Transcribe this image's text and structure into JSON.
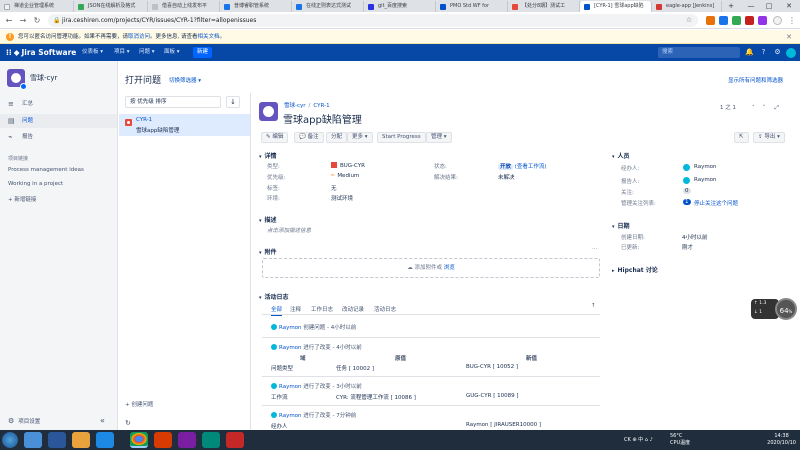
{
  "browser": {
    "tabs": [
      {
        "label": "禅道企业管理系统",
        "color": "#ffffff"
      },
      {
        "label": "JSON在线解析及格式",
        "color": "#34a853"
      },
      {
        "label": "借喜自动上线发布平",
        "color": "#e8eaed"
      },
      {
        "label": "普博睿职管系统",
        "color": "#1a73e8"
      },
      {
        "label": "在线正则表达式测试",
        "color": "#1a73e8"
      },
      {
        "label": "git_百度搜索",
        "color": "#2932e1"
      },
      {
        "label": "PMO Std WF for ",
        "color": "#0052cc"
      },
      {
        "label": "【处分8期】测试工",
        "color": "#e5493a"
      },
      {
        "label": "[CYR-1] 雪球app缺陷",
        "color": "#0052cc"
      },
      {
        "label": "eagle-app [Jenkins]",
        "color": "#d33833"
      }
    ],
    "new_tab": "+",
    "url": "jira.ceshiren.com/projects/CYR/issues/CYR-1?filter=allopenissues",
    "window_controls": [
      "—",
      "□",
      "✕"
    ]
  },
  "warning": {
    "text": "您可以匿名访问管理功能。如果不再需要，请",
    "link1": "取消访问",
    "mid": "。更多信息, 请查看",
    "link2": "相关文档",
    "end": "。"
  },
  "jira_nav": {
    "product": "Jira Software",
    "items": [
      "仪表板 ▾",
      "项目 ▾",
      "问题 ▾",
      "面板 ▾"
    ],
    "create": "新建",
    "search_placeholder": "搜索"
  },
  "sidebar": {
    "project_name": "雪球-cyr",
    "items": [
      {
        "label": "汇总",
        "icon": "≡"
      },
      {
        "label": "问题",
        "icon": "▤"
      },
      {
        "label": "报告",
        "icon": "📈"
      }
    ],
    "shortcuts_title": "项目链接",
    "links": [
      "Process management ideas",
      "Working in a project"
    ],
    "add_link": "+ 新增链接",
    "settings": "项目设置",
    "collapse": "«"
  },
  "filter": {
    "title": "打开问题",
    "switch": "切换筛选器 ▾",
    "view_all": "显示所有问题和筛选器",
    "sort": "按 优先级 排序",
    "sort_dir": "↓",
    "create_issue": "+ 创建问题",
    "refresh": "↻"
  },
  "issue_list": [
    {
      "key": "CYR-1",
      "summary": "雪球app缺陷管理"
    }
  ],
  "issue": {
    "project": "雪球-cyr",
    "key": "CYR-1",
    "title": "雪球app缺陷管理",
    "pager": "1 之 1",
    "toolbar": [
      "✎ 编辑",
      "💬 备注",
      "分配",
      "更多 ▾",
      "Start Progress",
      "管理 ▾"
    ],
    "export": "⇪ 导出 ▾",
    "details_title": "详情",
    "details": {
      "type_label": "类型:",
      "type_value": "BUG-CYR",
      "priority_label": "优先级:",
      "priority_value": "Medium",
      "labels_label": "标签:",
      "labels_value": "无",
      "env_label": "环境:",
      "env_value": "测试环境",
      "status_label": "状态:",
      "status_value": "开放",
      "status_link": "(查看工作流)",
      "resolution_label": "解决结果:",
      "resolution_value": "未解决"
    },
    "description_title": "描述",
    "description_placeholder": "点击添加描述信息",
    "attachments_title": "附件",
    "attach_text": "添加附件或",
    "attach_link": "浏览",
    "people_title": "人员",
    "people": {
      "assignee_label": "经办人:",
      "assignee": "Raymon",
      "reporter_label": "报告人:",
      "reporter": "Raymon",
      "votes_label": "关注:",
      "votes": "0",
      "watchers_label": "管理关注列表:",
      "watchers_count": "1",
      "watchers_link": "停止关注这个问题"
    },
    "dates_title": "日期",
    "dates": {
      "created_label": "创建日期:",
      "created": "4小时以前",
      "updated_label": "已更新:",
      "updated": "刚才"
    },
    "hipchat_title": "Hipchat 讨论",
    "activity_title": "活动日志",
    "activity_tabs": [
      "全部",
      "注释",
      "工作日志",
      "改动记录",
      "活动日志"
    ],
    "activity_sort": "↑",
    "activity": {
      "e1_user": "Raymon",
      "e1_text": "创建问题 - 4小时以前",
      "e2_user": "Raymon",
      "e2_text": "进行了改变 - 4小时以前",
      "col_field": "域",
      "col_old": "原值",
      "col_new": "新值",
      "e2_field": "问题类型",
      "e2_old": "任务 [ 10002 ]",
      "e2_new": "BUG-CYR [ 10052 ]",
      "e3_user": "Raymon",
      "e3_text": "进行了改变 - 3小时以前",
      "e3_field": "工作流",
      "e3_old": "CYR: 流程管理工作流 [ 10086 ]",
      "e3_new": "GUG-CYR [ 10089 ]",
      "e4_user": "Raymon",
      "e4_text": "进行了改变 - 7分钟前",
      "e4_field": "经办人",
      "e4_new": "Raymon [ JIRAUSER10000 ]"
    }
  },
  "overlay": {
    "cpu_value": "64",
    "cpu_unit": "%",
    "up": "1.3",
    "down": "1"
  },
  "taskbar": {
    "tray_text": "CK ⊕ 中 ⌂ ♪",
    "weather": "56°C",
    "weather_sub": "CPU温度",
    "time": "14:38",
    "date": "2020/10/10"
  }
}
